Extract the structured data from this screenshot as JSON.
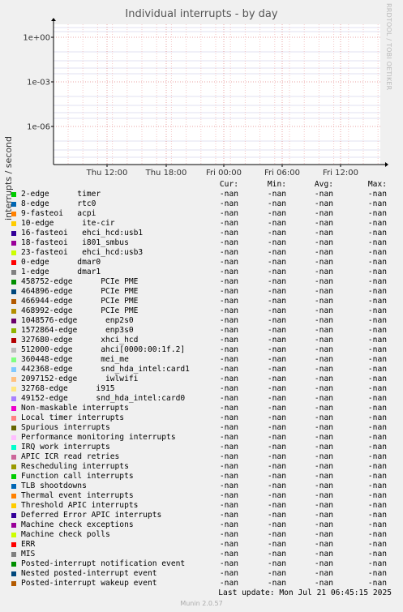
{
  "chart_data": {
    "type": "line",
    "title": "Individual interrupts - by day",
    "ylabel": "interrupts / second",
    "yscale": "log",
    "y_ticks": [
      "1e+00",
      "1e-03",
      "1e-06"
    ],
    "x_ticks": [
      "Thu 12:00",
      "Thu 18:00",
      "Fri 00:00",
      "Fri 06:00",
      "Fri 12:00"
    ],
    "grid": true,
    "series": []
  },
  "side_label": "RRDTOOL / TOBI OETIKER",
  "legend": {
    "headers": [
      "Cur:",
      "Min:",
      "Avg:",
      "Max:"
    ],
    "rows": [
      {
        "name": "2-edge      timer",
        "color": "#00cc00",
        "cur": "-nan",
        "min": "-nan",
        "avg": "-nan",
        "max": "-nan"
      },
      {
        "name": "8-edge      rtc0",
        "color": "#0066b3",
        "cur": "-nan",
        "min": "-nan",
        "avg": "-nan",
        "max": "-nan"
      },
      {
        "name": "9-fasteoi   acpi",
        "color": "#ff8000",
        "cur": "-nan",
        "min": "-nan",
        "avg": "-nan",
        "max": "-nan"
      },
      {
        "name": "10-edge      ite-cir",
        "color": "#ffcc00",
        "cur": "-nan",
        "min": "-nan",
        "avg": "-nan",
        "max": "-nan"
      },
      {
        "name": "16-fasteoi   ehci_hcd:usb1",
        "color": "#330099",
        "cur": "-nan",
        "min": "-nan",
        "avg": "-nan",
        "max": "-nan"
      },
      {
        "name": "18-fasteoi   i801_smbus",
        "color": "#990099",
        "cur": "-nan",
        "min": "-nan",
        "avg": "-nan",
        "max": "-nan"
      },
      {
        "name": "23-fasteoi   ehci_hcd:usb3",
        "color": "#ccff00",
        "cur": "-nan",
        "min": "-nan",
        "avg": "-nan",
        "max": "-nan"
      },
      {
        "name": "0-edge      dmar0",
        "color": "#ff0000",
        "cur": "-nan",
        "min": "-nan",
        "avg": "-nan",
        "max": "-nan"
      },
      {
        "name": "1-edge      dmar1",
        "color": "#808080",
        "cur": "-nan",
        "min": "-nan",
        "avg": "-nan",
        "max": "-nan"
      },
      {
        "name": "458752-edge      PCIe PME",
        "color": "#008f00",
        "cur": "-nan",
        "min": "-nan",
        "avg": "-nan",
        "max": "-nan"
      },
      {
        "name": "464896-edge      PCIe PME",
        "color": "#00487d",
        "cur": "-nan",
        "min": "-nan",
        "avg": "-nan",
        "max": "-nan"
      },
      {
        "name": "466944-edge      PCIe PME",
        "color": "#b35a00",
        "cur": "-nan",
        "min": "-nan",
        "avg": "-nan",
        "max": "-nan"
      },
      {
        "name": "468992-edge      PCIe PME",
        "color": "#b38f00",
        "cur": "-nan",
        "min": "-nan",
        "avg": "-nan",
        "max": "-nan"
      },
      {
        "name": "1048576-edge      enp2s0",
        "color": "#6b006b",
        "cur": "-nan",
        "min": "-nan",
        "avg": "-nan",
        "max": "-nan"
      },
      {
        "name": "1572864-edge      enp3s0",
        "color": "#8fb300",
        "cur": "-nan",
        "min": "-nan",
        "avg": "-nan",
        "max": "-nan"
      },
      {
        "name": "327680-edge      xhci_hcd",
        "color": "#b30000",
        "cur": "-nan",
        "min": "-nan",
        "avg": "-nan",
        "max": "-nan"
      },
      {
        "name": "512000-edge      ahci[0000:00:1f.2]",
        "color": "#bebebe",
        "cur": "-nan",
        "min": "-nan",
        "avg": "-nan",
        "max": "-nan"
      },
      {
        "name": "360448-edge      mei_me",
        "color": "#80ff80",
        "cur": "-nan",
        "min": "-nan",
        "avg": "-nan",
        "max": "-nan"
      },
      {
        "name": "442368-edge      snd_hda_intel:card1",
        "color": "#80c9ff",
        "cur": "-nan",
        "min": "-nan",
        "avg": "-nan",
        "max": "-nan"
      },
      {
        "name": "2097152-edge      iwlwifi",
        "color": "#ffc080",
        "cur": "-nan",
        "min": "-nan",
        "avg": "-nan",
        "max": "-nan"
      },
      {
        "name": "32768-edge      i915",
        "color": "#ffe680",
        "cur": "-nan",
        "min": "-nan",
        "avg": "-nan",
        "max": "-nan"
      },
      {
        "name": "49152-edge      snd_hda_intel:card0",
        "color": "#aa80ff",
        "cur": "-nan",
        "min": "-nan",
        "avg": "-nan",
        "max": "-nan"
      },
      {
        "name": "Non-maskable interrupts",
        "color": "#ee00cc",
        "cur": "-nan",
        "min": "-nan",
        "avg": "-nan",
        "max": "-nan"
      },
      {
        "name": "Local timer interrupts",
        "color": "#ff8080",
        "cur": "-nan",
        "min": "-nan",
        "avg": "-nan",
        "max": "-nan"
      },
      {
        "name": "Spurious interrupts",
        "color": "#666600",
        "cur": "-nan",
        "min": "-nan",
        "avg": "-nan",
        "max": "-nan"
      },
      {
        "name": "Performance monitoring interrupts",
        "color": "#ffbfff",
        "cur": "-nan",
        "min": "-nan",
        "avg": "-nan",
        "max": "-nan"
      },
      {
        "name": "IRQ work interrupts",
        "color": "#00ffcc",
        "cur": "-nan",
        "min": "-nan",
        "avg": "-nan",
        "max": "-nan"
      },
      {
        "name": "APIC ICR read retries",
        "color": "#cc6699",
        "cur": "-nan",
        "min": "-nan",
        "avg": "-nan",
        "max": "-nan"
      },
      {
        "name": "Rescheduling interrupts",
        "color": "#999900",
        "cur": "-nan",
        "min": "-nan",
        "avg": "-nan",
        "max": "-nan"
      },
      {
        "name": "Function call interrupts",
        "color": "#00cc00",
        "cur": "-nan",
        "min": "-nan",
        "avg": "-nan",
        "max": "-nan"
      },
      {
        "name": "TLB shootdowns",
        "color": "#0066b3",
        "cur": "-nan",
        "min": "-nan",
        "avg": "-nan",
        "max": "-nan"
      },
      {
        "name": "Thermal event interrupts",
        "color": "#ff8000",
        "cur": "-nan",
        "min": "-nan",
        "avg": "-nan",
        "max": "-nan"
      },
      {
        "name": "Threshold APIC interrupts",
        "color": "#ffcc00",
        "cur": "-nan",
        "min": "-nan",
        "avg": "-nan",
        "max": "-nan"
      },
      {
        "name": "Deferred Error APIC interrupts",
        "color": "#330099",
        "cur": "-nan",
        "min": "-nan",
        "avg": "-nan",
        "max": "-nan"
      },
      {
        "name": "Machine check exceptions",
        "color": "#990099",
        "cur": "-nan",
        "min": "-nan",
        "avg": "-nan",
        "max": "-nan"
      },
      {
        "name": "Machine check polls",
        "color": "#ccff00",
        "cur": "-nan",
        "min": "-nan",
        "avg": "-nan",
        "max": "-nan"
      },
      {
        "name": "ERR",
        "color": "#ff0000",
        "cur": "-nan",
        "min": "-nan",
        "avg": "-nan",
        "max": "-nan"
      },
      {
        "name": "MIS",
        "color": "#808080",
        "cur": "-nan",
        "min": "-nan",
        "avg": "-nan",
        "max": "-nan"
      },
      {
        "name": "Posted-interrupt notification event",
        "color": "#008f00",
        "cur": "-nan",
        "min": "-nan",
        "avg": "-nan",
        "max": "-nan"
      },
      {
        "name": "Nested posted-interrupt event",
        "color": "#00487d",
        "cur": "-nan",
        "min": "-nan",
        "avg": "-nan",
        "max": "-nan"
      },
      {
        "name": "Posted-interrupt wakeup event",
        "color": "#b35a00",
        "cur": "-nan",
        "min": "-nan",
        "avg": "-nan",
        "max": "-nan"
      }
    ]
  },
  "last_update": "Last update: Mon Jul 21 06:45:15 2025",
  "version": "Munin 2.0.57"
}
